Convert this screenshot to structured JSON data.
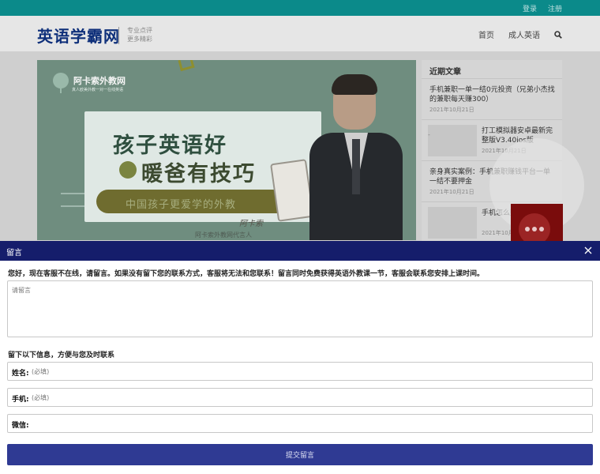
{
  "topbar": {
    "login": "登录",
    "register": "注册"
  },
  "header": {
    "logo": "英语学霸网",
    "tagline_line1": "专业点评",
    "tagline_line2": "更多精彩",
    "nav": [
      "首页",
      "成人英语"
    ]
  },
  "banner": {
    "brand": "阿卡索外教网",
    "brand_sub": "真人欧美外教一对一在线英语",
    "headline1": "孩子英语好",
    "headline2": "暖爸有技巧",
    "pill_text": "中国孩子更爱学的外教",
    "signature": "阿卡索",
    "caption": "阿卡索外教网代言人"
  },
  "sidebar": {
    "heading": "近期文章",
    "posts": [
      {
        "title": "手机兼职一单一结0元投资（兄弟小杰找的兼职每天赚300）",
        "date": "2021年10月21日"
      },
      {
        "title": "打工模拟器安卓最新完整版V3.40ios版",
        "date": "2021年10月21日",
        "thumb_label": "-"
      },
      {
        "title": "亲身真实案例：手机兼职赚钱平台一单一结不要押金",
        "date": "2021年10月21日"
      },
      {
        "title": "手机怎么赚零花钱",
        "date": "2021年10月21日"
      }
    ]
  },
  "modal": {
    "title": "留言",
    "notice": "您好，现在客服不在线，请留言。如果没有留下您的联系方式，客服将无法和您联系！留言同时免费获得英语外教课一节，客服会联系您安排上课时间。",
    "message_placeholder": "请留言",
    "subhead": "留下以下信息，方便与您及时联系",
    "fields": [
      {
        "label": "姓名:",
        "placeholder": "(必填)"
      },
      {
        "label": "手机:",
        "placeholder": "(必填)"
      },
      {
        "label": "微信:",
        "placeholder": ""
      }
    ],
    "submit": "提交留言"
  },
  "colors": {
    "topbar": "#0b8a8a",
    "logo": "#0e2f7a",
    "modal_header": "#151d6b",
    "submit_button": "#2f3a93",
    "chat_bubble": "#7a0c0c"
  },
  "icons": [
    "search-icon",
    "close-icon",
    "chat-icon",
    "tree-logo-icon"
  ]
}
